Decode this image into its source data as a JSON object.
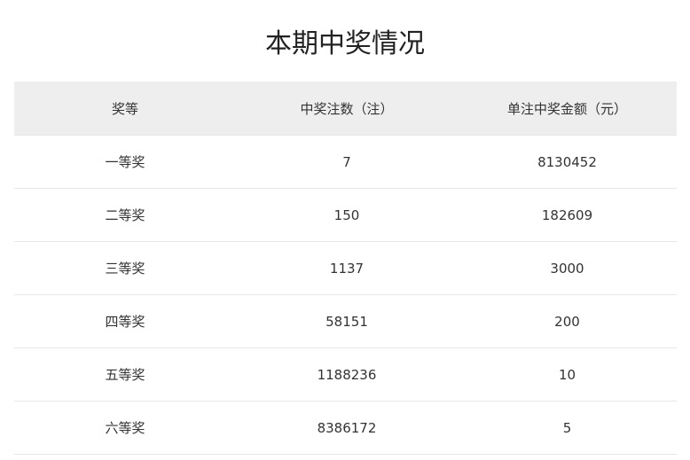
{
  "page": {
    "title": "本期中奖情况"
  },
  "table": {
    "columns": [
      "奖等",
      "中奖注数（注）",
      "单注中奖金额（元）"
    ],
    "rows": [
      {
        "level": "一等奖",
        "count": "7",
        "amount": "8130452"
      },
      {
        "level": "二等奖",
        "count": "150",
        "amount": "182609"
      },
      {
        "level": "三等奖",
        "count": "1137",
        "amount": "3000"
      },
      {
        "level": "四等奖",
        "count": "58151",
        "amount": "200"
      },
      {
        "level": "五等奖",
        "count": "1188236",
        "amount": "10"
      },
      {
        "level": "六等奖",
        "count": "8386172",
        "amount": "5"
      }
    ]
  },
  "colors": {
    "header_background": "#eeeeee",
    "row_divider": "#e6e6e6",
    "text": "#333333"
  }
}
